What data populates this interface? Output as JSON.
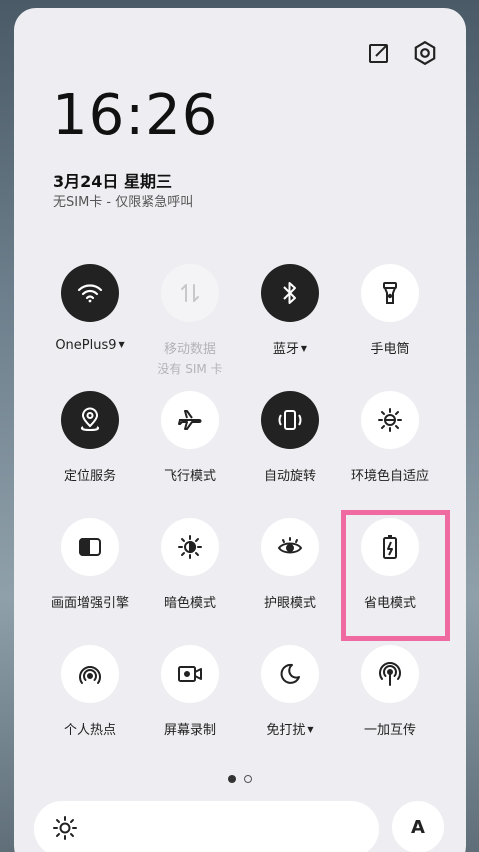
{
  "header": {
    "time": "16:26",
    "date": "3月24日  星期三",
    "sim_status": "无SIM卡 - 仅限紧急呼叫"
  },
  "tiles": [
    {
      "label": "OnePlus9",
      "caret": "▼",
      "state": "on",
      "icon": "wifi-icon"
    },
    {
      "label": "移动数据",
      "sub": "没有 SIM 卡",
      "state": "disabled",
      "icon": "mobile-data-icon"
    },
    {
      "label": "蓝牙",
      "caret": "▼",
      "state": "on",
      "icon": "bluetooth-icon"
    },
    {
      "label": "手电筒",
      "state": "off",
      "icon": "flashlight-icon"
    },
    {
      "label": "定位服务",
      "state": "on",
      "icon": "location-icon"
    },
    {
      "label": "飞行模式",
      "state": "off",
      "icon": "airplane-icon"
    },
    {
      "label": "自动旋转",
      "state": "on",
      "icon": "auto-rotate-icon"
    },
    {
      "label": "环境色自适应",
      "state": "off",
      "icon": "ambient-color-icon"
    },
    {
      "label": "画面增强引擎",
      "state": "off",
      "icon": "display-enhance-icon"
    },
    {
      "label": "暗色模式",
      "state": "off",
      "icon": "dark-mode-icon"
    },
    {
      "label": "护眼模式",
      "state": "off",
      "icon": "eye-comfort-icon"
    },
    {
      "label": "省电模式",
      "state": "off",
      "icon": "battery-saver-icon"
    },
    {
      "label": "个人热点",
      "state": "off",
      "icon": "hotspot-icon"
    },
    {
      "label": "屏幕录制",
      "state": "off",
      "icon": "screen-record-icon"
    },
    {
      "label": "免打扰",
      "caret": "▼",
      "state": "off",
      "icon": "do-not-disturb-icon"
    },
    {
      "label": "一加互传",
      "state": "off",
      "icon": "oneplus-share-icon"
    }
  ],
  "pager": {
    "pages": 2,
    "current": 1
  },
  "brightness": {
    "auto_label": "A"
  },
  "colors": {
    "panel": "#eeeef2",
    "tile_on": "#222222",
    "tile_off": "#ffffff",
    "highlight": "#ef6aa0"
  }
}
